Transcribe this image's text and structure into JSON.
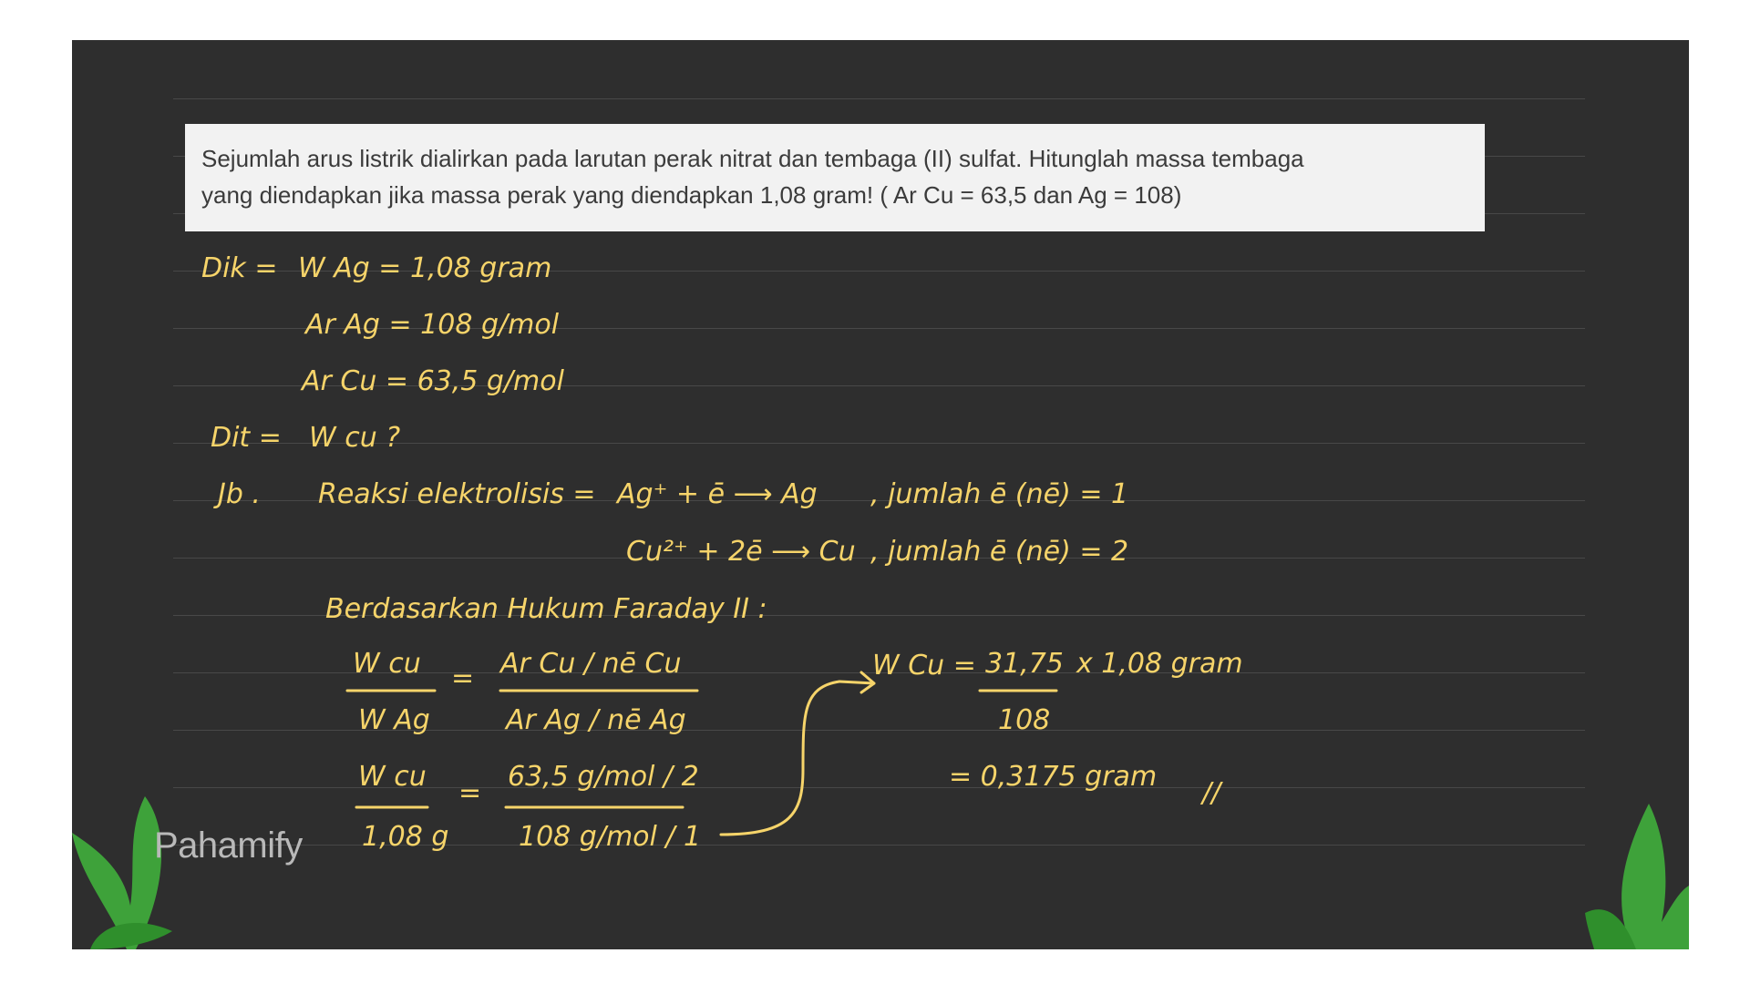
{
  "question": {
    "line1": "Sejumlah arus listrik dialirkan pada larutan perak nitrat dan tembaga (II) sulfat. Hitunglah massa tembaga",
    "line2": "yang diendapkan jika massa perak yang diendapkan 1,08 gram! ( Ar Cu = 63,5 dan Ag = 108)"
  },
  "notes": {
    "dik": {
      "label": "Dik =",
      "items": [
        "W Ag  =  1,08 gram",
        "Ar Ag  =  108 g/mol",
        "Ar Cu  =  63,5 g/mol"
      ]
    },
    "dit": {
      "label": "Dit =",
      "value": "W cu ?"
    },
    "jb": {
      "label": "Jb .",
      "reaksi_label": "Reaksi elektrolisis  =",
      "reaction1": "Ag⁺ + ē ⟶ Ag",
      "count1": ", jumlah ē (nē) = 1",
      "reaction2": "Cu²⁺ + 2ē ⟶ Cu",
      "count2": ", jumlah ē (nē) = 2"
    },
    "faraday": "Berdasarkan Hukum Faraday II :",
    "ratio": {
      "left_num": "W cu",
      "left_den": "W Ag",
      "eq": "=",
      "right_num": "Ar Cu / nē Cu",
      "right_den": "Ar Ag / nē Ag"
    },
    "ratio2": {
      "left_num": "W cu",
      "left_den": "1,08 g",
      "eq": "=",
      "right_num": "63,5 g/mol / 2",
      "right_den": "108 g/mol / 1"
    },
    "result": {
      "lhs": "W Cu  =",
      "num": "31,75",
      "times": "x 1,08 gram",
      "den": "108",
      "final": "=  0,3175 gram",
      "mark": "//"
    }
  },
  "brand": "Pahamify",
  "colors": {
    "board": "#2e2e2e",
    "ink": "#f6d46a",
    "leaf": "#3ea23a"
  }
}
